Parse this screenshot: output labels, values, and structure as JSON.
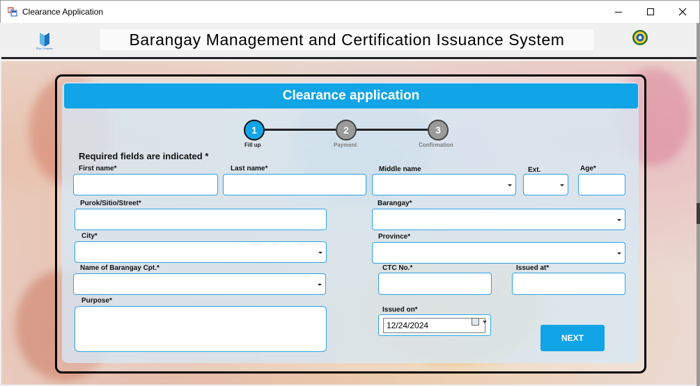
{
  "window": {
    "title": "Clearance Application"
  },
  "header": {
    "system_title": "Barangay Management and Certification Issuance System",
    "company_name": "Blue Company"
  },
  "form": {
    "heading": "Clearance application",
    "steps": [
      {
        "number": "1",
        "label": "Fill up",
        "state": "active"
      },
      {
        "number": "2",
        "label": "Payment",
        "state": "inactive"
      },
      {
        "number": "3",
        "label": "Confirmation",
        "state": "inactive"
      }
    ],
    "required_note": "Required fields are indicated *",
    "fields": {
      "first_name": {
        "label": "First name*",
        "value": ""
      },
      "last_name": {
        "label": "Last name*",
        "value": ""
      },
      "middle_name": {
        "label": "Middle name",
        "value": ""
      },
      "ext": {
        "label": "Ext.",
        "value": ""
      },
      "age": {
        "label": "Age*",
        "value": ""
      },
      "purok": {
        "label": "Purok/Sitio/Street*",
        "value": ""
      },
      "barangay": {
        "label": "Barangay*",
        "value": ""
      },
      "city": {
        "label": "City*",
        "value": ""
      },
      "province": {
        "label": "Province*",
        "value": ""
      },
      "barangay_cpt": {
        "label": "Name of Barangay Cpt.*",
        "value": ""
      },
      "ctc_no": {
        "label": "CTC No.*",
        "value": ""
      },
      "issued_at": {
        "label": "Issued at*",
        "value": ""
      },
      "purpose": {
        "label": "Purpose*",
        "value": ""
      },
      "issued_on": {
        "label": "Issued on*",
        "value": "12/24/2024"
      }
    },
    "next_label": "NEXT"
  },
  "colors": {
    "accent": "#11a4e6",
    "field_border": "#2ba3e8",
    "panel_border": "#000000"
  },
  "icons": {
    "app": "app-window-icon",
    "logo": "company-logo-icon",
    "seal": "barangay-seal-icon",
    "calendar": "calendar-icon"
  }
}
